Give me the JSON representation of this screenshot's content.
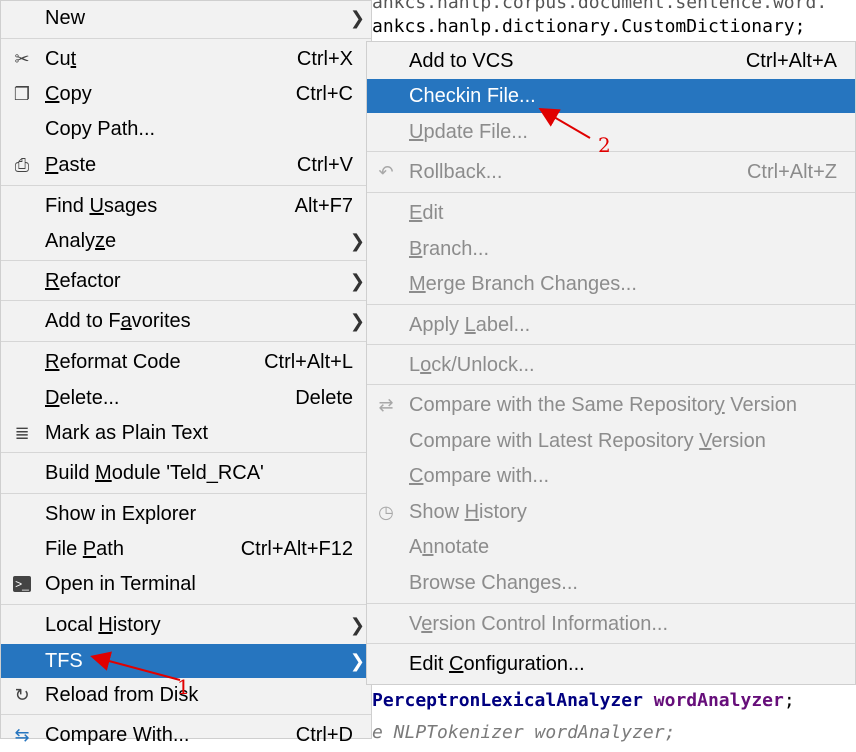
{
  "editor": {
    "line1": "ankcs.hanlp.corpus.document.sentence.word.",
    "line2": "ankcs.hanlp.dictionary.CustomDictionary;",
    "line3_type": "PerceptronLexicalAnalyzer",
    "line3_var": "wordAnalyzer",
    "line3_end": ";",
    "line4": "e NLPTokenizer wordAnalyzer;"
  },
  "main_menu": {
    "new": "New",
    "cut": {
      "pre": "Cu",
      "u": "t",
      "post": "",
      "shortcut": "Ctrl+X"
    },
    "copy": {
      "pre": "",
      "u": "C",
      "post": "opy",
      "shortcut": "Ctrl+C"
    },
    "copy_path": "Copy Path...",
    "paste": {
      "pre": "",
      "u": "P",
      "post": "aste",
      "shortcut": "Ctrl+V"
    },
    "find_usages": {
      "pre": "Find ",
      "u": "U",
      "post": "sages",
      "shortcut": "Alt+F7"
    },
    "analyze": {
      "pre": "Analy",
      "u": "z",
      "post": "e"
    },
    "refactor": {
      "pre": "",
      "u": "R",
      "post": "efactor"
    },
    "add_favorites": {
      "pre": "Add to F",
      "u": "a",
      "post": "vorites"
    },
    "reformat": {
      "pre": "",
      "u": "R",
      "post": "eformat Code",
      "shortcut": "Ctrl+Alt+L"
    },
    "delete": {
      "pre": "",
      "u": "D",
      "post": "elete...",
      "shortcut": "Delete"
    },
    "mark_plain": "Mark as Plain Text",
    "build_module": {
      "pre": "Build ",
      "u": "M",
      "post": "odule 'Teld_RCA'"
    },
    "show_explorer": "Show in Explorer",
    "file_path": {
      "pre": "File ",
      "u": "P",
      "post": "ath",
      "shortcut": "Ctrl+Alt+F12"
    },
    "open_terminal": "Open in Terminal",
    "local_history": {
      "pre": "Local ",
      "u": "H",
      "post": "istory"
    },
    "tfs": "TFS",
    "reload": "Reload from Disk",
    "compare_with": "Compare With...",
    "compare_shortcut": "Ctrl+D"
  },
  "sub_menu": {
    "add_vcs": {
      "label": "Add to VCS",
      "shortcut": "Ctrl+Alt+A"
    },
    "checkin": "Checkin File...",
    "update": {
      "pre": "",
      "u": "U",
      "post": "pdate File..."
    },
    "rollback": {
      "label": "Rollback...",
      "shortcut": "Ctrl+Alt+Z"
    },
    "edit": {
      "pre": "",
      "u": "E",
      "post": "dit"
    },
    "branch": {
      "pre": "",
      "u": "B",
      "post": "ranch..."
    },
    "merge": {
      "pre": "",
      "u": "M",
      "post": "erge Branch Changes..."
    },
    "apply_label": {
      "pre": "Apply ",
      "u": "L",
      "post": "abel..."
    },
    "lock": {
      "pre": "L",
      "u": "o",
      "post": "ck/Unlock..."
    },
    "cmp_same": {
      "pre": "Compare with the Same Repositor",
      "u": "y",
      "post": " Version"
    },
    "cmp_latest": {
      "pre": "Compare with Latest Repository ",
      "u": "V",
      "post": "ersion"
    },
    "cmp_with": {
      "pre": "",
      "u": "C",
      "post": "ompare with..."
    },
    "show_history": {
      "pre": "Show ",
      "u": "H",
      "post": "istory"
    },
    "annotate": {
      "pre": "A",
      "u": "n",
      "post": "notate"
    },
    "browse": "Browse Changes...",
    "vc_info": {
      "pre": "V",
      "u": "e",
      "post": "rsion Control Information..."
    },
    "edit_config": {
      "pre": "Edit ",
      "u": "C",
      "post": "onfiguration..."
    }
  },
  "annotations": {
    "one": "1",
    "two": "2",
    "color": "#e00000"
  },
  "colors": {
    "selection": "#2675bf",
    "menu_bg": "#f2f2f2",
    "disabled": "#8c8c8c"
  }
}
